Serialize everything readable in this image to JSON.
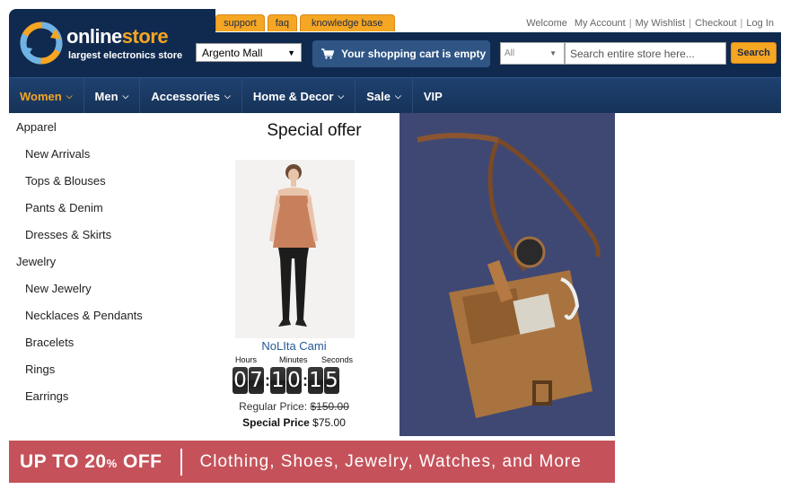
{
  "top_tabs": [
    "support",
    "faq",
    "knowledge base"
  ],
  "top_links": [
    "Welcome",
    "My Account",
    "My Wishlist",
    "Checkout",
    "Log In"
  ],
  "logo": {
    "title_part1": "online",
    "title_part2": "store",
    "subtitle": "largest electronics store"
  },
  "store_select": {
    "value": "Argento Mall"
  },
  "cart": {
    "label": "Your shopping cart is empty"
  },
  "search": {
    "category": "All",
    "placeholder": "Search entire store here...",
    "button": "Search"
  },
  "nav": [
    {
      "label": "Women",
      "dropdown": true,
      "active": true
    },
    {
      "label": "Men",
      "dropdown": true
    },
    {
      "label": "Accessories",
      "dropdown": true
    },
    {
      "label": "Home & Decor",
      "dropdown": true
    },
    {
      "label": "Sale",
      "dropdown": true
    },
    {
      "label": "VIP",
      "dropdown": false
    }
  ],
  "menu": {
    "apparel": "Apparel",
    "apparel_items": [
      "New Arrivals",
      "Tops & Blouses",
      "Pants & Denim",
      "Dresses & Skirts"
    ],
    "jewelry": "Jewelry",
    "jewelry_items": [
      "New Jewelry",
      "Necklaces & Pendants",
      "Bracelets",
      "Rings",
      "Earrings"
    ]
  },
  "offer": {
    "title": "Special offer",
    "product_name": "NoLIta Cami",
    "timer_labels": {
      "hours": "Hours",
      "minutes": "Minutes",
      "seconds": "Seconds"
    },
    "timer": {
      "h1": "0",
      "h2": "7",
      "m1": "1",
      "m2": "0",
      "s1": "1",
      "s2": "5"
    },
    "regular_label": "Regular Price:",
    "regular_price": "$150.00",
    "special_label": "Special Price",
    "special_price": "$75.00"
  },
  "banner": {
    "left_a": "UP TO 20",
    "left_pct": "%",
    "left_b": " OFF",
    "right": "Clothing, Shoes, Jewelry, Watches, and More"
  },
  "colors": {
    "navy": "#102a4f",
    "nav": "#1f4170",
    "accent": "#f5a623",
    "banner": "#c5525a",
    "link": "#245a96"
  }
}
